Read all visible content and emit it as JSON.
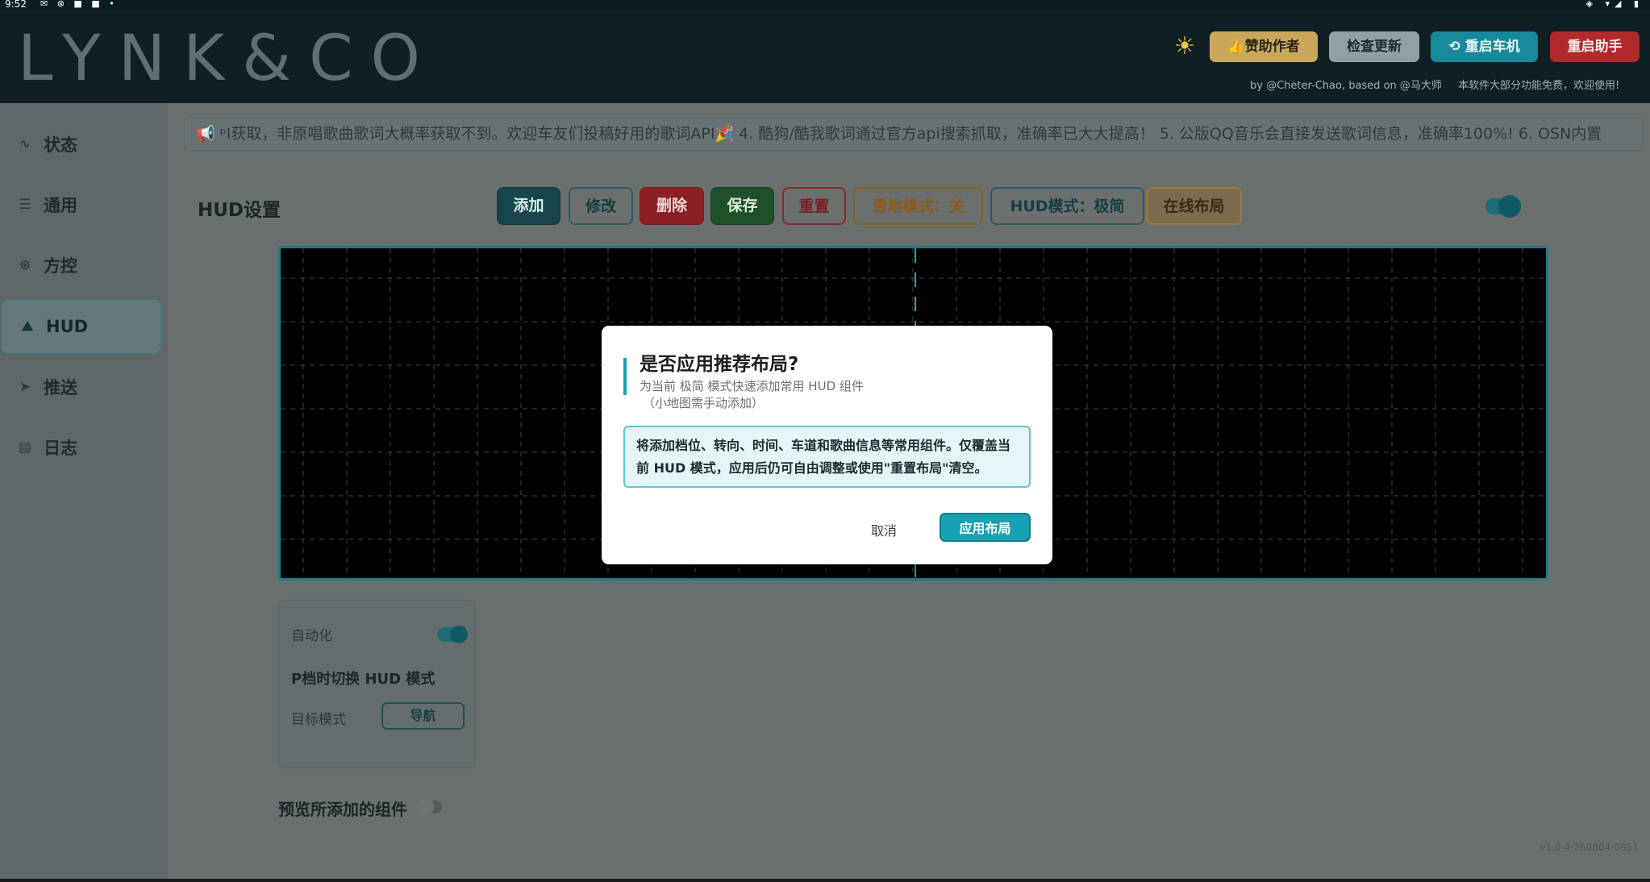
{
  "statusbar": {
    "time": "9:52",
    "left_icons": "✉ ⊗ ■ ■ •",
    "right_icons": "◈ ▾◢ ▮"
  },
  "header": {
    "logo": "LYNK&CO",
    "sponsor_label": "👍赞助作者",
    "update_label": "检查更新",
    "reboot_label": "⟲ 重启车机",
    "assist_label": "重启助手",
    "credit": "by @Cheter-Chao, based on @马大师",
    "notice": "本软件大部分功能免费，欢迎使用!"
  },
  "sidebar": {
    "items": [
      {
        "label": "状态",
        "icon": "pulse-icon",
        "glyph": "∿"
      },
      {
        "label": "通用",
        "icon": "sliders-icon",
        "glyph": "☰"
      },
      {
        "label": "方控",
        "icon": "steering-wheel-icon",
        "glyph": "⊛"
      },
      {
        "label": "HUD",
        "icon": "hud-icon",
        "glyph": "⛰"
      },
      {
        "label": "推送",
        "icon": "send-icon",
        "glyph": "➤"
      },
      {
        "label": "日志",
        "icon": "log-icon",
        "glyph": "▤"
      }
    ]
  },
  "ticker": {
    "text": "ᵖI获取，非原唱歌曲歌词大概率获取不到。欢迎车友们投稿好用的歌词API🎉   4. 酷狗/酷我歌词通过官方api搜索抓取，准确率已大大提高！   5. 公版QQ音乐会直接发送歌词信息，准确率100%!   6. OSN内置"
  },
  "hud": {
    "title": "HUD设置",
    "toolbar": {
      "add": "添加",
      "edit": "修改",
      "delete": "删除",
      "save": "保存",
      "reset": "重置",
      "snow_mode": "雪地模式：关",
      "hud_mode": "HUD模式：极简",
      "online_layout": "在线布局"
    },
    "enabled": true
  },
  "automation": {
    "label": "自动化",
    "enabled": true,
    "description": "P档时切换 HUD 模式",
    "target_label": "目标模式",
    "target_value": "导航"
  },
  "preview": {
    "label": "预览所添加的组件",
    "enabled": false
  },
  "version": "v1.0.4-260804-0951",
  "dialog": {
    "title": "是否应用推荐布局?",
    "subtitle": "为当前 极简 模式快速添加常用 HUD 组件",
    "subnote": "（小地图需手动添加）",
    "info": "将添加档位、转向、时间、车道和歌曲信息等常用组件。仅覆盖当前 HUD 模式，应用后仍可自由调整或使用\"重置布局\"清空。",
    "cancel": "取消",
    "apply": "应用布局"
  },
  "colors": {
    "accent": "#17a2b4",
    "danger": "#8a2024",
    "success": "#1f4f27",
    "warning": "#8a5e22",
    "header_bg": "#0f1f25"
  }
}
